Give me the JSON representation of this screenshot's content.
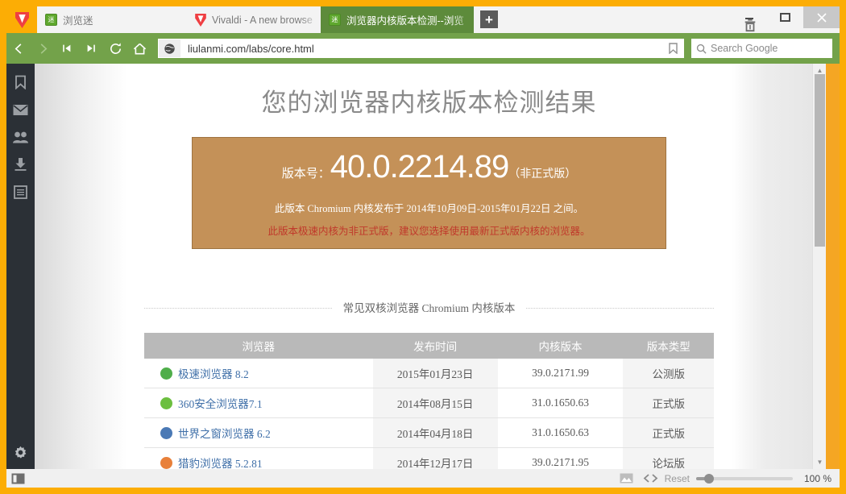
{
  "browser": {
    "name": "Vivaldi",
    "accent_orange": "#fcad05",
    "accent_green": "#73a24a",
    "tabs": [
      {
        "title": "浏览迷",
        "favicon": "liulanmi-icon",
        "active": false
      },
      {
        "title": "Vivaldi - A new browser for",
        "favicon": "vivaldi-icon",
        "active": false
      },
      {
        "title": "浏览器内核版本检测--浏览",
        "favicon": "liulanmi-icon",
        "active": true
      }
    ],
    "new_tab_label": "+",
    "window_controls": {
      "minimize": "−",
      "maximize": "▭",
      "close": "✕",
      "trash": "trash-icon"
    },
    "toolbar": {
      "back": "back-icon",
      "forward": "forward-icon",
      "rewind": "rewind-icon",
      "fastforward": "fastforward-icon",
      "reload": "reload-icon",
      "home": "home-icon",
      "url": "liulanmi.com/labs/core.html",
      "page_bookmark": "bookmark-icon",
      "search_placeholder": "Search Google"
    },
    "panel_items": [
      {
        "name": "bookmarks",
        "icon": "bookmark-icon"
      },
      {
        "name": "mail",
        "icon": "mail-icon"
      },
      {
        "name": "contacts",
        "icon": "contacts-icon"
      },
      {
        "name": "downloads",
        "icon": "download-icon"
      },
      {
        "name": "notes",
        "icon": "notes-icon"
      }
    ],
    "panel_settings_icon": "gear-icon",
    "statusbar": {
      "panel_toggle": "panel-toggle-icon",
      "image_toggle": "image-icon",
      "code_toggle": "code-icon",
      "reset_label": "Reset",
      "zoom_value": "100 %"
    }
  },
  "page": {
    "title": "您的浏览器内核版本检测结果",
    "version_box": {
      "label": "版本号：",
      "number": "40.0.2214.89",
      "suffix": "（非正式版）",
      "description": "此版本 Chromium 内核发布于 2014年10月09日-2015年01月22日 之间。",
      "warning": "此版本极速内核为非正式版，建议您选择使用最新正式版内核的浏览器。",
      "bg_color": "#c49158"
    },
    "section_heading": "常见双核浏览器 Chromium 内核版本",
    "table": {
      "headers": [
        "浏览器",
        "发布时间",
        "内核版本",
        "版本类型"
      ],
      "rows": [
        {
          "browser": "极速浏览器 8.2",
          "date": "2015年01月23日",
          "core": "39.0.2171.99",
          "type": "公测版",
          "type_class": "type-beta",
          "icon_color": "#4fae4a"
        },
        {
          "browser": "360安全浏览器7.1",
          "date": "2014年08月15日",
          "core": "31.0.1650.63",
          "type": "正式版",
          "type_class": "type-release",
          "icon_color": "#6cbf3f"
        },
        {
          "browser": "世界之窗浏览器 6.2",
          "date": "2014年04月18日",
          "core": "31.0.1650.63",
          "type": "正式版",
          "type_class": "type-release",
          "icon_color": "#4a79b5"
        },
        {
          "browser": "猎豹浏览器 5.2.81",
          "date": "2014年12月17日",
          "core": "39.0.2171.95",
          "type": "论坛版",
          "type_class": "type-forum",
          "icon_color": "#e8803a"
        }
      ]
    }
  }
}
